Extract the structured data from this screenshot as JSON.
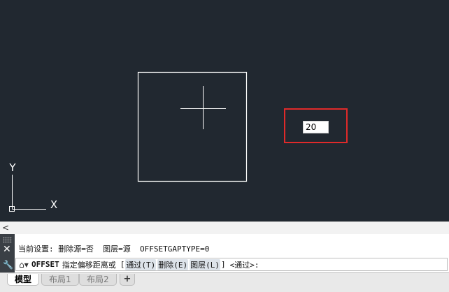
{
  "app": {
    "name": "CAD drawing editor"
  },
  "colors": {
    "canvas_background": "#212830",
    "drawing_stroke": "#ffffff",
    "highlight_border": "#e02a2a"
  },
  "canvas": {
    "dynamic_input_value": "20",
    "ucs_x_label": "X",
    "ucs_y_label": "Y"
  },
  "scrollbar": {
    "left_arrow": "<"
  },
  "command": {
    "close_glyph": "✕",
    "history_line": "当前设置: 删除源=否  图层=源  OFFSETGAPTYPE=0",
    "prompt_command": "OFFSET",
    "prompt_text": "指定偏移距离或",
    "open_bracket": "[",
    "options": [
      "通过(T)",
      "删除(E)",
      "图层(L)"
    ],
    "close_bracket": "]",
    "default_option": "<通过>:"
  },
  "layout_tabs": {
    "tabs": [
      "模型",
      "布局1",
      "布局2"
    ],
    "active": "模型",
    "add_label": "+"
  }
}
